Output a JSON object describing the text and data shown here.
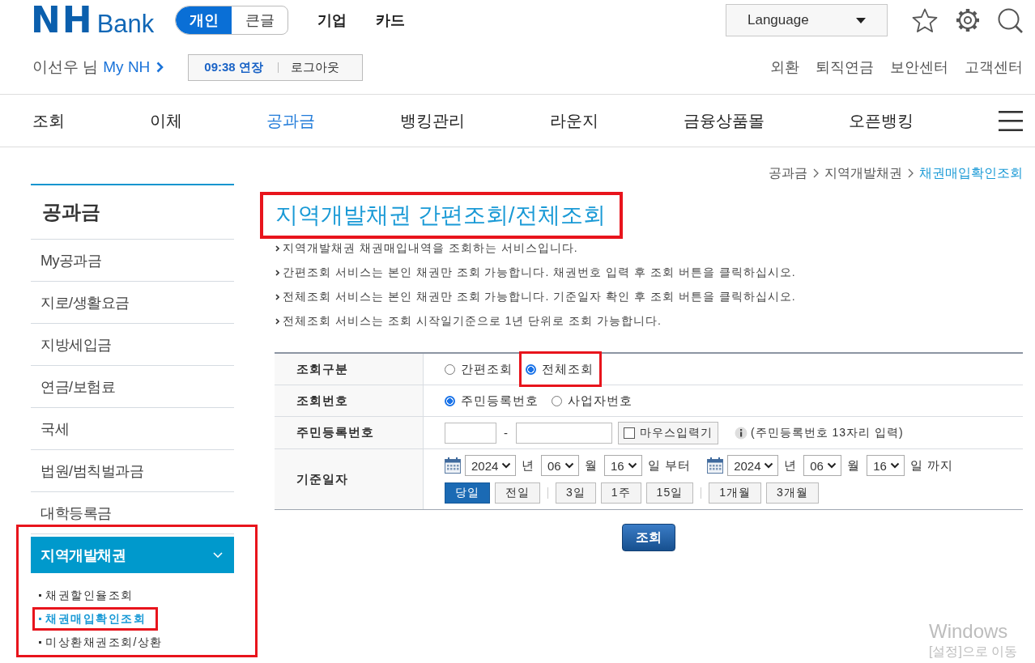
{
  "header": {
    "logo": {
      "mark": "NH",
      "name": "Bank"
    },
    "view_tabs": [
      {
        "label": "개인",
        "selected": true
      },
      {
        "label": "큰글",
        "selected": false
      }
    ],
    "top_links": [
      "기업",
      "카드"
    ],
    "language_select": {
      "value": "Language"
    },
    "user": {
      "greeting": "이선우 님",
      "link": "My NH"
    },
    "session": {
      "timer": "09:38 연장",
      "logout": "로그아웃"
    },
    "utility_links": [
      "외환",
      "퇴직연금",
      "보안센터",
      "고객센터"
    ]
  },
  "main_nav": [
    {
      "label": "조회",
      "selected": false
    },
    {
      "label": "이체",
      "selected": false
    },
    {
      "label": "공과금",
      "selected": true
    },
    {
      "label": "뱅킹관리",
      "selected": false
    },
    {
      "label": "라운지",
      "selected": false
    },
    {
      "label": "금융상품몰",
      "selected": false
    },
    {
      "label": "오픈뱅킹",
      "selected": false
    }
  ],
  "sidebar": {
    "title": "공과금",
    "items": [
      {
        "label": "My공과금",
        "selected": false,
        "highlighted": false
      },
      {
        "label": "지로/생활요금",
        "selected": false,
        "highlighted": false
      },
      {
        "label": "지방세입금",
        "selected": false,
        "highlighted": false
      },
      {
        "label": "연금/보험료",
        "selected": false,
        "highlighted": false
      },
      {
        "label": "국세",
        "selected": false,
        "highlighted": false
      },
      {
        "label": "법원/범칙벌과금",
        "selected": false,
        "highlighted": false
      },
      {
        "label": "대학등록금",
        "selected": false,
        "highlighted": false
      },
      {
        "label": "지역개발채권",
        "selected": true,
        "highlighted": true,
        "children": [
          {
            "label": "채권할인율조회",
            "selected": false,
            "highlighted": false
          },
          {
            "label": "채권매입확인조회",
            "selected": true,
            "highlighted": true
          },
          {
            "label": "미상환채권조회/상환",
            "selected": false,
            "highlighted": false
          }
        ]
      }
    ]
  },
  "breadcrumb": [
    {
      "label": "공과금",
      "selected": false
    },
    {
      "label": "지역개발채권",
      "selected": false
    },
    {
      "label": "채권매입확인조회",
      "selected": true
    }
  ],
  "page_title": {
    "text": "지역개발채권 간편조회/전체조회",
    "highlighted": true
  },
  "notes": [
    "지역개발채권 채권매입내역을 조회하는 서비스입니다.",
    "간편조회 서비스는 본인 채권만 조회 가능합니다. 채권번호 입력 후 조회 버튼을 클릭하십시오.",
    "전체조회 서비스는 본인 채권만 조회 가능합니다. 기준일자 확인 후 조회 버튼을 클릭하십시오.",
    "전체조회 서비스는 조회 시작일기준으로 1년 단위로 조회 가능합니다."
  ],
  "form": {
    "rows": [
      {
        "kind": "radio",
        "label": "조회구분",
        "options": [
          {
            "label": "간편조회",
            "selected": false,
            "highlighted": false
          },
          {
            "label": "전체조회",
            "selected": true,
            "highlighted": true
          }
        ]
      },
      {
        "kind": "radio",
        "label": "조회번호",
        "options": [
          {
            "label": "주민등록번호",
            "selected": true,
            "highlighted": false
          },
          {
            "label": "사업자번호",
            "selected": false,
            "highlighted": false
          }
        ]
      },
      {
        "kind": "id_number",
        "label": "주민등록번호",
        "separator": "-",
        "keypad": {
          "label": "마우스입력기",
          "checked": false
        },
        "hint": "(주민등록번호 13자리 입력)"
      },
      {
        "kind": "date_range",
        "label": "기준일자",
        "from": {
          "year": "2024",
          "year_unit": "년",
          "month": "06",
          "month_unit": "월",
          "day": "16",
          "day_unit": "일 부터"
        },
        "to": {
          "year": "2024",
          "year_unit": "년",
          "month": "06",
          "month_unit": "월",
          "day": "16",
          "day_unit": "일 까지"
        },
        "quick_buttons": [
          [
            {
              "label": "당일",
              "selected": true
            },
            {
              "label": "전일",
              "selected": false
            }
          ],
          [
            {
              "label": "3일",
              "selected": false
            },
            {
              "label": "1주",
              "selected": false
            },
            {
              "label": "15일",
              "selected": false
            }
          ],
          [
            {
              "label": "1개월",
              "selected": false
            },
            {
              "label": "3개월",
              "selected": false
            }
          ]
        ]
      }
    ]
  },
  "submit_button": {
    "label": "조회"
  },
  "windows_notice": {
    "title": "Windows",
    "subtitle": "[설정]으로 이동"
  }
}
